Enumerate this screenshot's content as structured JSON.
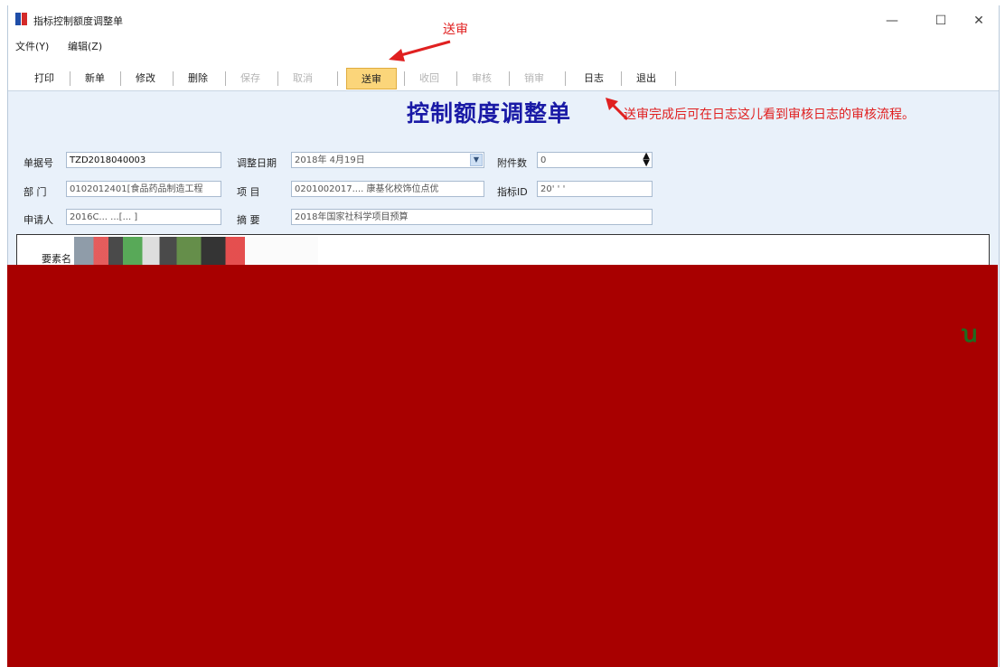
{
  "window": {
    "title": "指标控制额度调整单",
    "controls": {
      "minimize": "—",
      "maximize": "☐",
      "close": "✕"
    }
  },
  "menu": {
    "file": "文件(Y)",
    "edit": "编辑(Z)"
  },
  "toolbar": {
    "print": "打印",
    "new": "新单",
    "modify": "修改",
    "delete": "删除",
    "save": "保存",
    "cancel": "取消",
    "submit": "送审",
    "recall": "收回",
    "audit": "审核",
    "unaudit": "销审",
    "log": "日志",
    "exit": "退出"
  },
  "annotations": {
    "submit_note": "送审",
    "log_note": "送审完成后可在日志这儿看到审核日志的审核流程。"
  },
  "form": {
    "title": "控制额度调整单",
    "doc_no_label": "单据号",
    "doc_no_value": "TZD2018040003",
    "date_label": "调整日期",
    "date_value": "2018年 4月19日",
    "attach_label": "附件数",
    "attach_value": "0",
    "dept_label": "部 门",
    "dept_value": "0102012401[食品药品制造工程",
    "project_label": "项 目",
    "project_value": "0201002017.... 康基化校饰位点优",
    "indicator_label": "指标ID",
    "indicator_value": "20' ' '",
    "applicant_label": "申请人",
    "applicant_value": "2016C... ...[... ]",
    "summary_label": "摘 要",
    "summary_value": "2018年国家社科学项目预算"
  },
  "grid": {
    "header_partial": "要素名"
  },
  "colors": {
    "redaction": "#a80000",
    "title_blue": "#1a1aa6",
    "annotation_red": "#e02020",
    "active_button": "#fbd57a"
  }
}
